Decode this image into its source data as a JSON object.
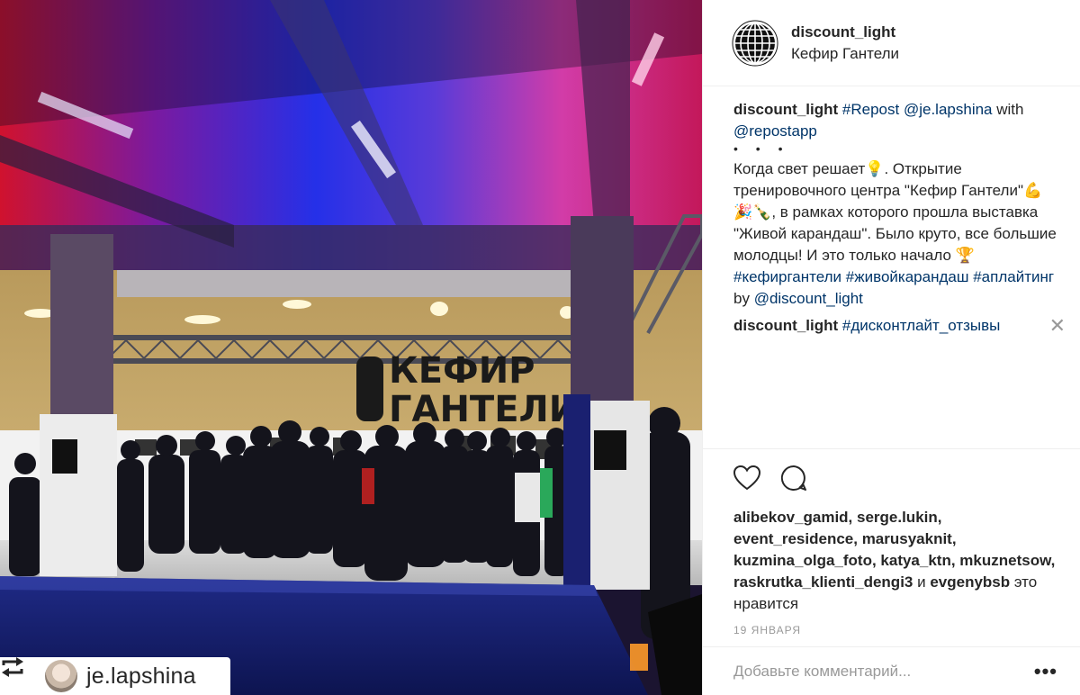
{
  "photo": {
    "sign_line1": "КЕФИР",
    "sign_line2": "ГАНТЕЛИ",
    "repost_tag": {
      "icon": "repost-icon",
      "username": "je.lapshina"
    }
  },
  "header": {
    "username": "discount_light",
    "location": "Кефир Гантели",
    "avatar_icon": "globe-icon"
  },
  "comments": {
    "first": {
      "author": "discount_light",
      "text_before": " ",
      "tag1": "#Repost",
      "mention1": "@je.lapshina",
      "text_mid": " with ",
      "mention2": "@repostapp",
      "dots": "• • •",
      "caption": "Когда свет решает💡. Открытие тренировочного центра \"Кефир Гантели\"💪🎉🍾, в рамках которого прошла выставка \"Живой карандаш\". Было круто, все большие молодцы! И это только начало 🏆 ",
      "tag2": "#кефиргантели",
      "tag3": "#живойкарандаш",
      "tag4": "#аплайтинг",
      "by": " by ",
      "mention3": "@discount_light"
    },
    "second": {
      "author": "discount_light",
      "tag": "#дисконтлайт_отзывы",
      "close": "✕"
    }
  },
  "actions": {
    "like_icon": "heart-icon",
    "comment_icon": "comment-icon"
  },
  "likes": {
    "users1": "alibekov_gamid, serge.lukin, event_residence, marusyaknit, kuzmina_olga_foto, katya_ktn, mkuznetsow, raskrutka_klienti_dengi3",
    "and": " и ",
    "users2": "evgenybsb",
    "suffix": " это нравится"
  },
  "date": "19 ЯНВАРЯ",
  "comment_box": {
    "placeholder": "Добавьте комментарий...",
    "more": "•••"
  }
}
